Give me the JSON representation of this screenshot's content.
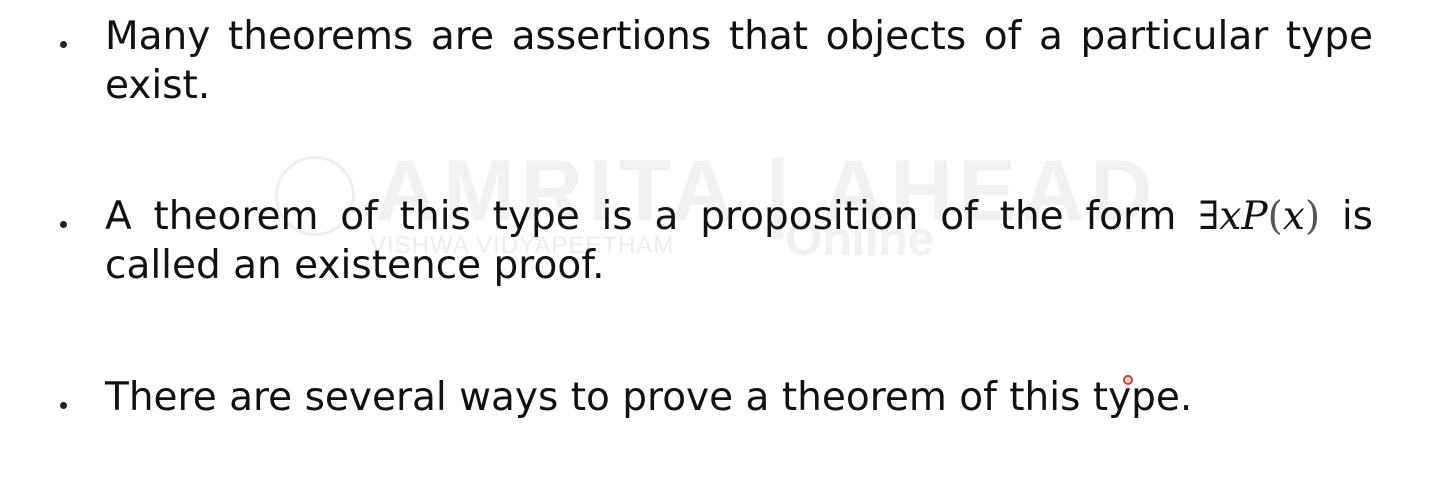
{
  "watermark": {
    "main": "AMRITA | AHEAD",
    "sub": "VISHWA VIDYAPEETHAM",
    "online": "Online"
  },
  "bullets": [
    {
      "text": "Many theorems are assertions that objects of a particular type exist."
    },
    {
      "text_before": "A theorem of this type is a proposition of the form ",
      "math": {
        "quantifier": "∃",
        "var": "x",
        "pred": "P",
        "open": "(",
        "arg": "x",
        "close": ")"
      },
      "text_after": " is called an existence proof."
    },
    {
      "text": "There are several ways to prove a theorem of this type."
    }
  ]
}
